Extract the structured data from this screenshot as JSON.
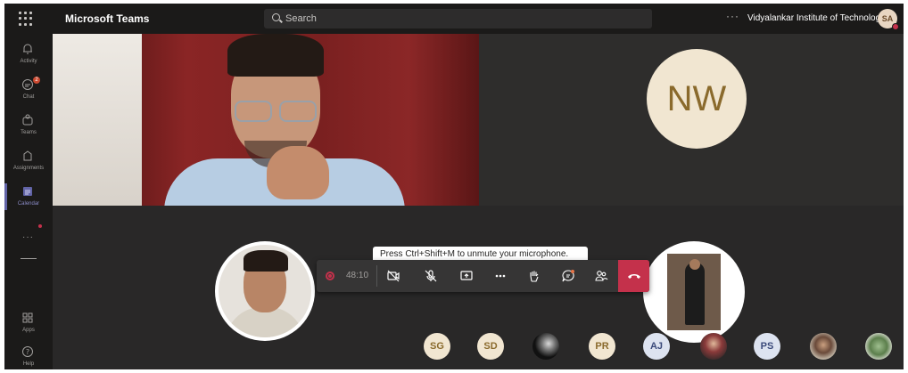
{
  "app": {
    "title": "Microsoft Teams"
  },
  "search": {
    "placeholder": "Search"
  },
  "header": {
    "more": "···",
    "org_name": "Vidyalankar Institute of Technology",
    "user_initials": "SA"
  },
  "rail": {
    "items": [
      {
        "label": "Activity",
        "icon": "bell-icon"
      },
      {
        "label": "Chat",
        "icon": "chat-icon",
        "badge": "2"
      },
      {
        "label": "Teams",
        "icon": "teams-icon"
      },
      {
        "label": "Assignments",
        "icon": "assignments-icon"
      },
      {
        "label": "Calendar",
        "icon": "calendar-icon",
        "active": true
      },
      {
        "label": "Apps",
        "icon": "apps-icon"
      },
      {
        "label": "Help",
        "icon": "help-icon"
      }
    ],
    "more": "···"
  },
  "stage": {
    "nw_initials": "NW"
  },
  "toolbar": {
    "tooltip": "Press Ctrl+Shift+M to unmute your microphone.",
    "timer": "48:10"
  },
  "participants": [
    {
      "initials": "SG"
    },
    {
      "initials": "SD"
    },
    {
      "initials": ""
    },
    {
      "initials": "PR"
    },
    {
      "initials": "AJ"
    },
    {
      "initials": ""
    },
    {
      "initials": "PS"
    },
    {
      "initials": ""
    },
    {
      "initials": ""
    }
  ],
  "colors": {
    "accent": "#6264a7",
    "hangup": "#c4314b",
    "avatar_gold": "#f1e6d1"
  }
}
